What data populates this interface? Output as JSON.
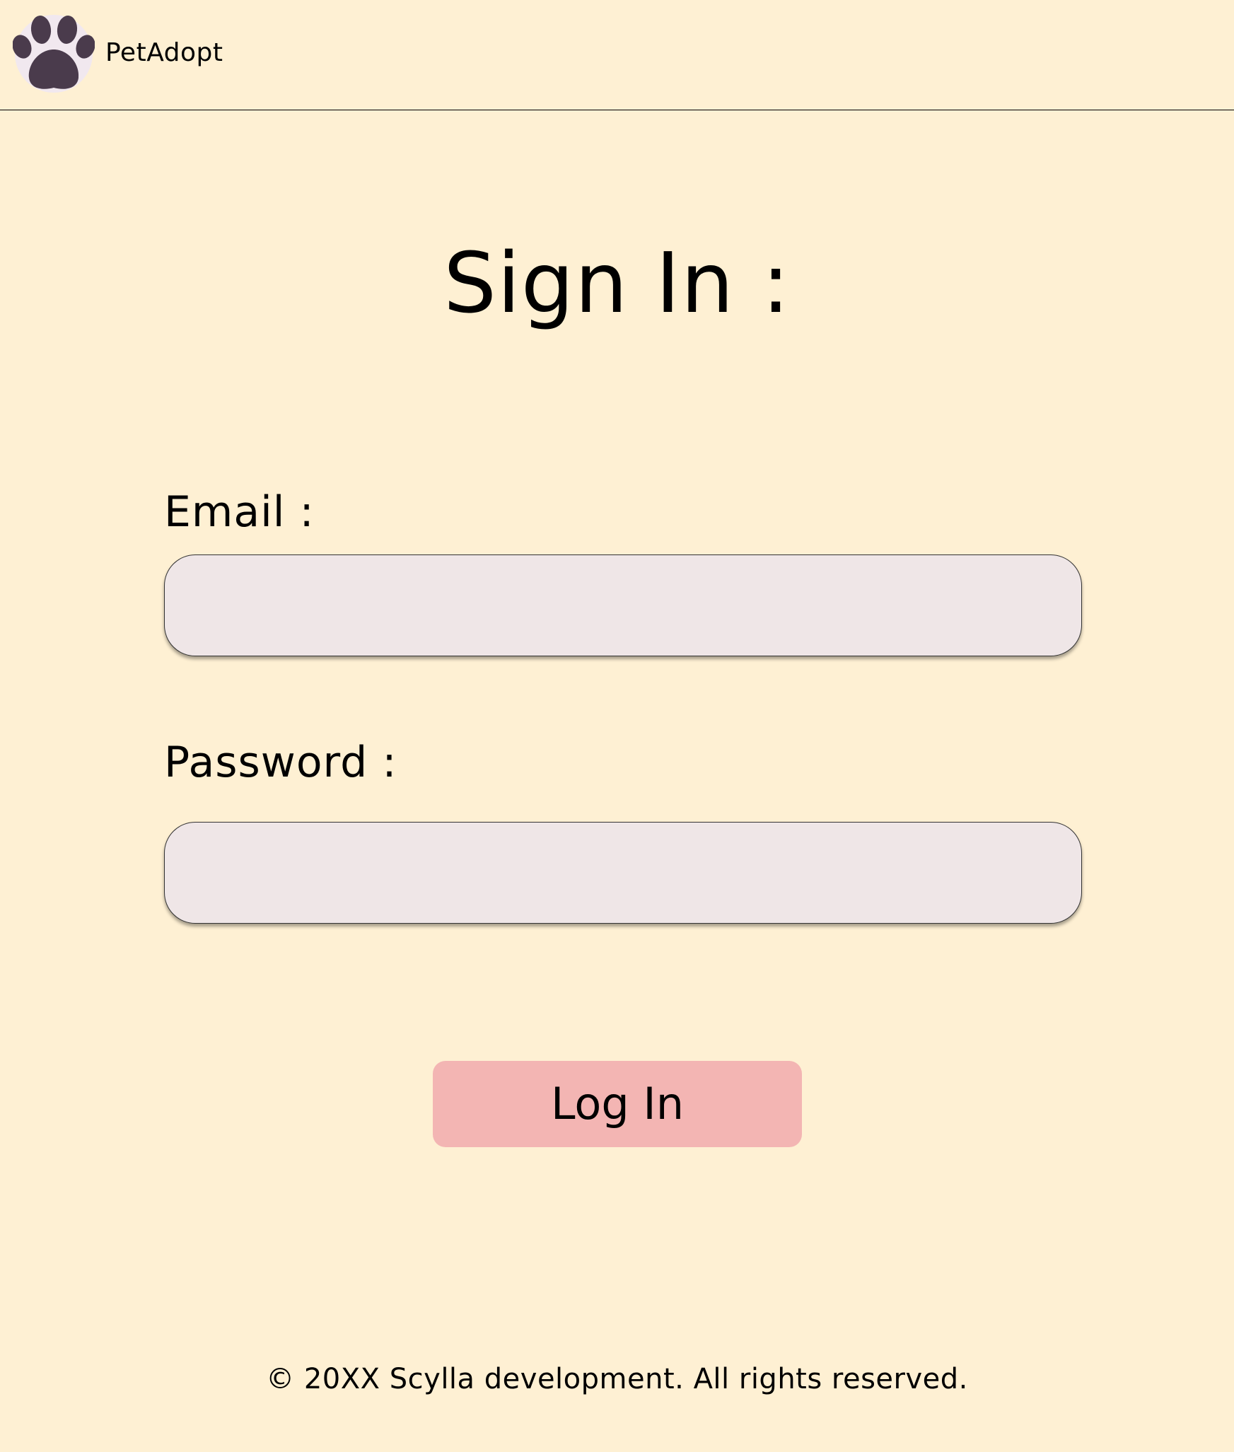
{
  "header": {
    "logo_icon": "paw-icon",
    "brand": "PetAdopt"
  },
  "main": {
    "title": "Sign In :",
    "email": {
      "label": "Email :",
      "value": "",
      "placeholder": ""
    },
    "password": {
      "label": "Password :",
      "value": "",
      "placeholder": ""
    },
    "login_label": "Log In"
  },
  "footer": {
    "text": "© 20XX Scylla development. All rights reserved."
  },
  "colors": {
    "background": "#FEF0D3",
    "input_fill": "#EFE6E7",
    "button_fill": "#F3B5B3",
    "logo_paw": "#4A3B4C"
  }
}
